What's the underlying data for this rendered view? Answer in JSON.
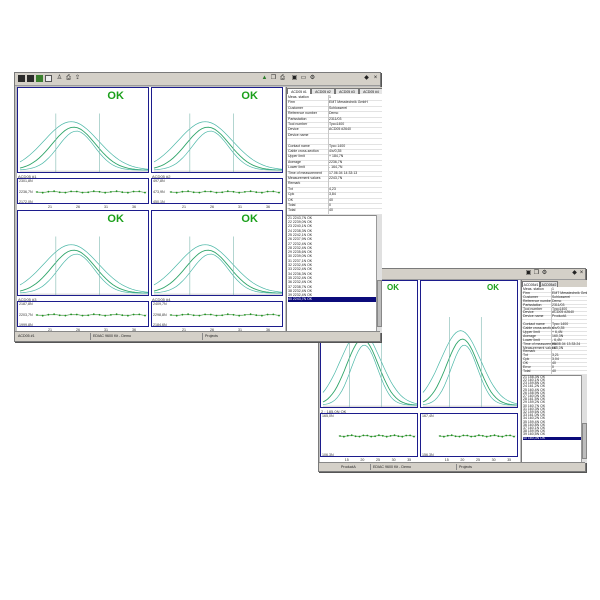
{
  "main": {
    "toolbar_right_icons": [
      "chart-icon",
      "copy-icon",
      "print-icon",
      "save-icon",
      "folder-icon",
      "settings-icon"
    ],
    "close_glyph": "×",
    "pin_glyph": "◆",
    "panels": [
      {
        "status": "OK",
        "name": "ACD05 #1",
        "yticks": [
          "2301,8N",
          "2236,7N",
          "2172,0N"
        ],
        "xticks": [
          "21",
          "26",
          "31",
          "36"
        ]
      },
      {
        "status": "OK",
        "name": "ACD05 #2",
        "yticks": [
          "497,8N",
          "473,9N",
          "450,1N"
        ],
        "xticks": [
          "21",
          "26",
          "31",
          "36"
        ]
      },
      {
        "status": "OK",
        "name": "ACD05 #3",
        "yticks": [
          "2187,8N",
          "2203,7N",
          "1999,8N"
        ],
        "xticks": [
          "21",
          "26",
          "31",
          "36"
        ]
      },
      {
        "status": "OK",
        "name": "ACD05 #4",
        "yticks": [
          "2409,7N",
          "2298,8N",
          "2184,6N"
        ],
        "xticks": [
          "21",
          "26",
          "31",
          "36"
        ]
      }
    ],
    "tabs": [
      "ACD05 #1",
      "ACD05 #2",
      "ACD05 #3",
      "ACD05 #4"
    ],
    "info_rows": [
      {
        "k": "Meas. station",
        "v": "1"
      },
      {
        "k": "Firm",
        "v": "EMT Messtechnik GmbH"
      },
      {
        "k": "Customer",
        "v": "Schlosserei"
      },
      {
        "k": "Reference number",
        "v": "Demo"
      },
      {
        "k": "Partsstation",
        "v": "2311/03"
      },
      {
        "k": "Tool number",
        "v": "Tyco1400"
      },
      {
        "k": "Device",
        "v": "ACD05 #2640"
      },
      {
        "k": "Device name",
        "v": ""
      },
      {
        "k": "",
        "v": ""
      },
      {
        "k": "Contact name",
        "v": "Tyco 1400"
      },
      {
        "k": "Cable cross-section",
        "v": "4/x/0,35"
      },
      {
        "k": "Upper limit",
        "v": "+ 184,7N"
      },
      {
        "k": "Average",
        "v": "2236,7N"
      },
      {
        "k": "Lower limit",
        "v": "- 164,7N"
      },
      {
        "k": "Time of measurement",
        "v": "17.06.04 14:33:13"
      },
      {
        "k": "Measurement values",
        "v": "2243,7N"
      },
      {
        "k": "Remark",
        "v": ""
      },
      {
        "k": "Txt",
        "v": "4,23"
      },
      {
        "k": "Cpk",
        "v": "3,84"
      },
      {
        "k": "OK",
        "v": "40"
      },
      {
        "k": "Total",
        "v": "0"
      },
      {
        "k": "Total",
        "v": "40"
      }
    ],
    "list": [
      "21  2243,7N OK",
      "22  2239,0N OK",
      "23  2240,1N OK",
      "24  2238,3N OK",
      "25  2242,1N OK",
      "26  2237,9N OK",
      "27  2232,4N OK",
      "28  2232,4N OK",
      "29  2235,6N OK",
      "30  2239,0N OK",
      "31  2237,1N OK",
      "32  2232,4N OK",
      "33  2232,4N OK",
      "34  2236,3N OK",
      "35  2232,4N OK",
      "36  2232,4N OK",
      "37  2238,7N OK",
      "38  2232,4N OK",
      "39  2232,4N OK",
      "40  2243,7N OK"
    ],
    "status": {
      "left": "ACD05 #1",
      "center": "EDIAC 9600 Kit - Demo",
      "right": "Projects"
    }
  },
  "back": {
    "panels": [
      {
        "status": "OK",
        "name": "2 : 185,0N OK",
        "yticks": [
          "165,0N",
          "106,3N"
        ],
        "xticks": [
          "15",
          "20",
          "25",
          "30",
          "35"
        ]
      },
      {
        "status": "OK",
        "name": "",
        "yticks": [
          "167,4N",
          "156,3N"
        ],
        "xticks": [
          "15",
          "20",
          "25",
          "30",
          "35"
        ]
      }
    ],
    "tabs": [
      "ACD05#1",
      "ACD05#2"
    ],
    "info_rows": [
      {
        "k": "Meas. station",
        "v": "1"
      },
      {
        "k": "Firm",
        "v": "EMT Messtechnik GmbH"
      },
      {
        "k": "Customer",
        "v": "Schlosserei"
      },
      {
        "k": "Reference number",
        "v": "Demo"
      },
      {
        "k": "Partsstation",
        "v": "2311/03"
      },
      {
        "k": "Tool number",
        "v": "Tyco1400"
      },
      {
        "k": "Device",
        "v": "ACD05 #2640"
      },
      {
        "k": "Device name",
        "v": "ProductA"
      },
      {
        "k": "",
        "v": ""
      },
      {
        "k": "Contact name",
        "v": "Tyco 1400"
      },
      {
        "k": "Cable cross-section",
        "v": "4/x/0,35"
      },
      {
        "k": "Upper limit",
        "v": "+ 6,4N"
      },
      {
        "k": "Average",
        "v": "160,3N"
      },
      {
        "k": "Lower limit",
        "v": "- 6,4N"
      },
      {
        "k": "Time of measurement",
        "v": "05.08.04 13:33:24"
      },
      {
        "k": "Measurement values",
        "v": "185,0N"
      },
      {
        "k": "Remark",
        "v": ""
      },
      {
        "k": "Txt",
        "v": "3,21"
      },
      {
        "k": "Cpk",
        "v": "3,04"
      },
      {
        "k": "OK",
        "v": "40"
      },
      {
        "k": "Error",
        "v": "0"
      },
      {
        "k": "Total",
        "v": "40"
      }
    ],
    "list": [
      "21  158,3N OK",
      "22  160,1N OK",
      "23  159,8N OK",
      "24  161,2N OK",
      "25  160,4N OK",
      "26  158,9N OK",
      "27  160,0N OK",
      "28  161,5N OK",
      "29  159,2N OK",
      "30  160,7N OK",
      "31  160,3N OK",
      "32  159,6N OK",
      "33  161,0N OK",
      "34  160,2N OK",
      "35  159,4N OK",
      "36  160,8N OK",
      "37  160,1N OK",
      "38  159,9N OK",
      "39  160,5N OK",
      "40  160,3N OK"
    ],
    "status": {
      "left": "ProductA",
      "center": "EDIAC 9600 Kit - Demo",
      "right": "Projects"
    }
  },
  "colors": {
    "ok": "#1a9f1a",
    "curve": "#2fa56a",
    "curve_light": "#4db8a8",
    "panel_border": "#1c1c8c",
    "selection": "#0b0b7a",
    "trend": "#1f8f1f"
  }
}
